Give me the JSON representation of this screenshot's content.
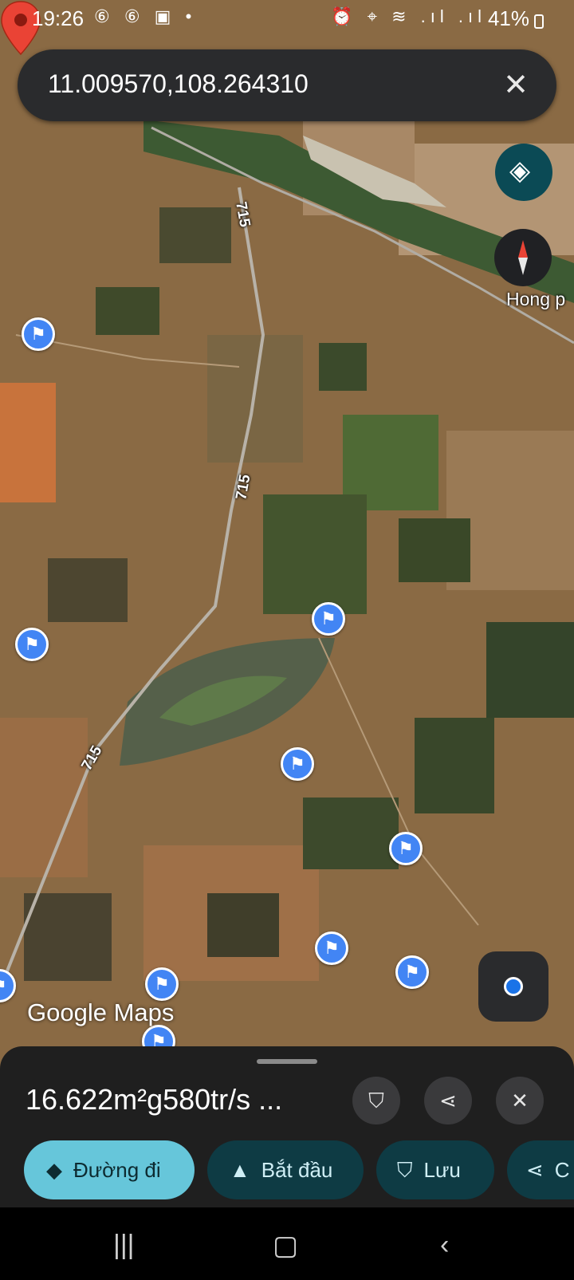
{
  "status": {
    "time": "19:26",
    "left_icons": "⑥ ⑥ ▣ •",
    "right_icons": "⏰ ⌖ ≋ .ıl .ıl",
    "battery": "41%"
  },
  "search": {
    "query": "11.009570,108.264310",
    "clear_icon": "close-icon"
  },
  "map": {
    "place_label": "Hong p",
    "road_labels": [
      "715",
      "715",
      "715"
    ],
    "pins": [
      {
        "icon": "flag-pin-icon",
        "glyph": "⚑"
      },
      {
        "icon": "flag-pin-icon",
        "glyph": "⚑"
      },
      {
        "icon": "flag-pin-icon",
        "glyph": "⚑"
      },
      {
        "icon": "flag-pin-icon",
        "glyph": "⚑"
      },
      {
        "icon": "flag-pin-icon",
        "glyph": "⚑"
      },
      {
        "icon": "flag-pin-icon",
        "glyph": "⚑"
      },
      {
        "icon": "flag-pin-icon",
        "glyph": "⚑"
      },
      {
        "icon": "flag-pin-icon",
        "glyph": "⚑"
      },
      {
        "icon": "flag-pin-icon",
        "glyph": "⚑"
      },
      {
        "icon": "flag-pin-icon",
        "glyph": "⚑"
      }
    ],
    "logo": "Google Maps"
  },
  "sheet": {
    "title": "16.622m²g580tr/s ...",
    "actions": [
      {
        "label": "Đường đi",
        "icon": "directions-icon",
        "glyph": "◆"
      },
      {
        "label": "Bắt đầu",
        "icon": "navigation-arrow-icon",
        "glyph": "▲"
      },
      {
        "label": "Lưu",
        "icon": "bookmark-icon",
        "glyph": "⛉"
      },
      {
        "label": "C",
        "icon": "share-icon",
        "glyph": "⋖"
      }
    ]
  },
  "colors": {
    "accent": "#66c6da",
    "pin_blue": "#4285f4",
    "marker_red": "#ea4335",
    "sheet_bg": "#1f1f1f"
  }
}
